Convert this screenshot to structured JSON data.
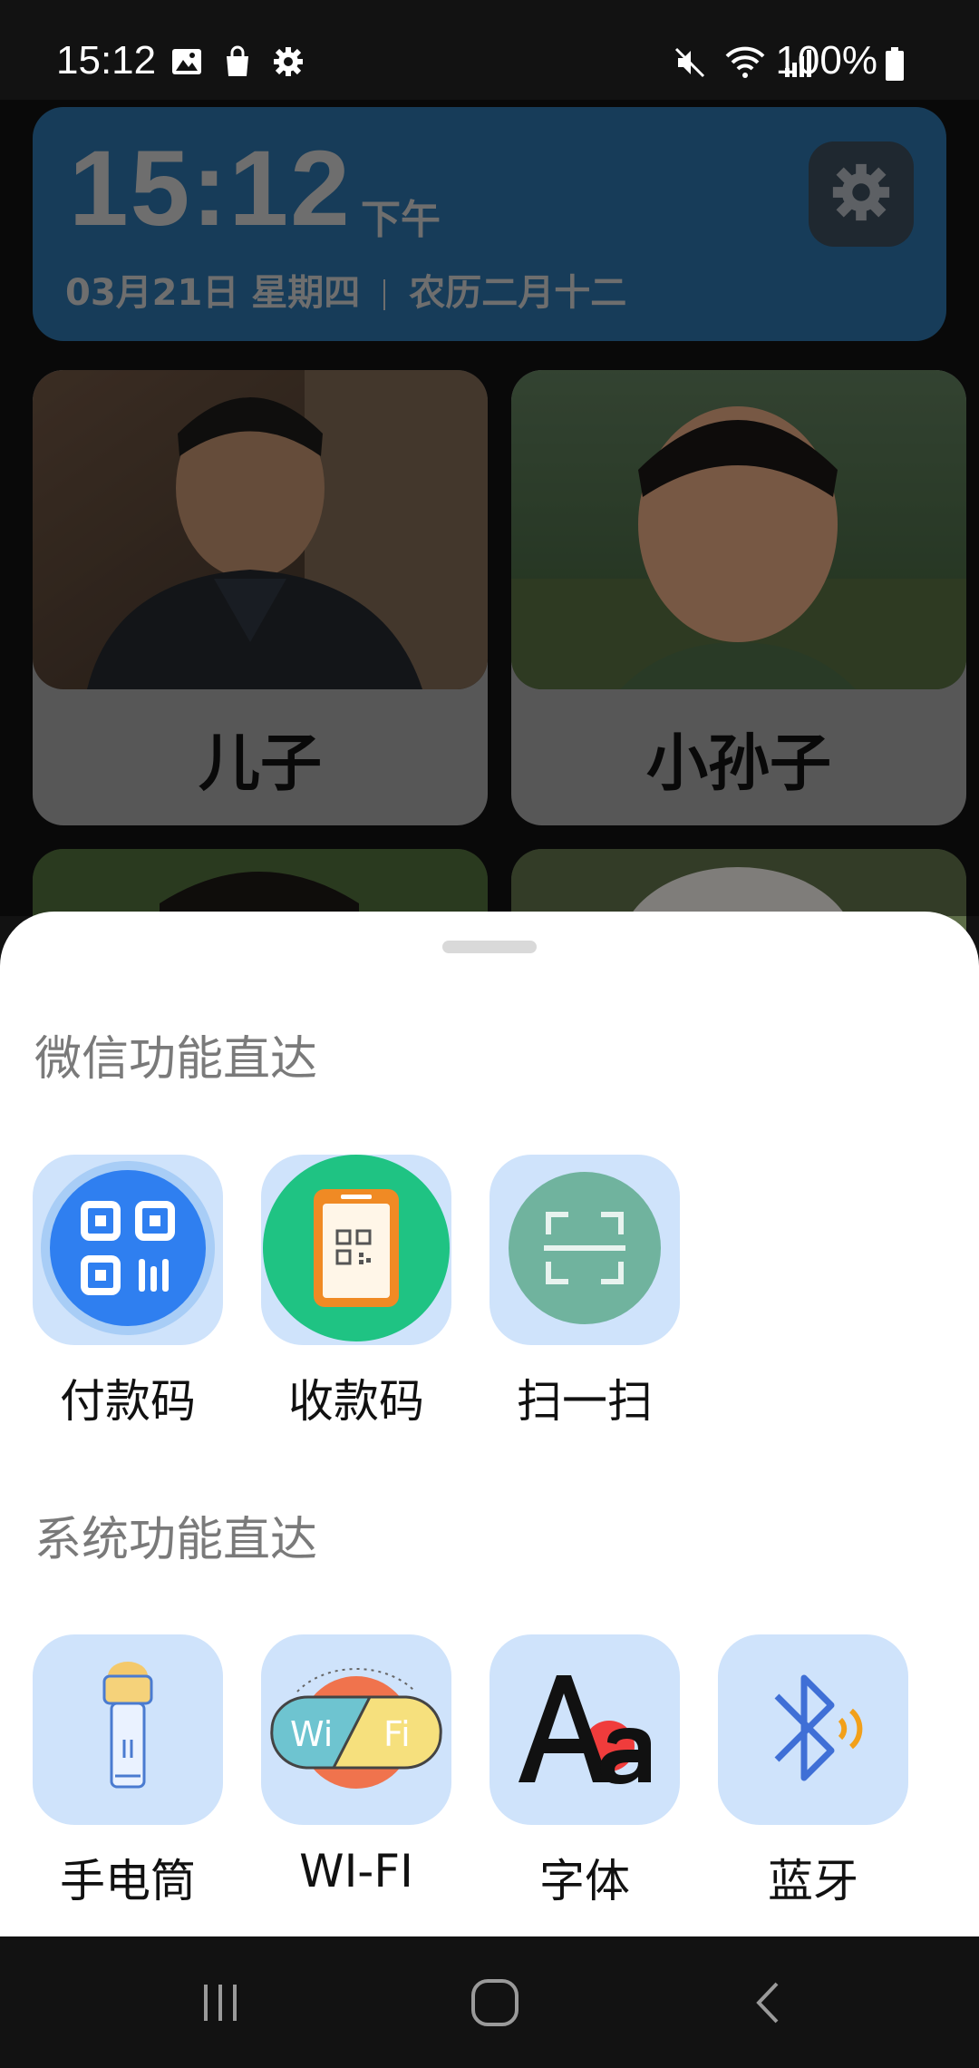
{
  "status_bar": {
    "time": "15:12",
    "battery": "100%",
    "icons_left": [
      "image-icon",
      "shopping-bag-icon",
      "gear-icon"
    ],
    "icons_right": [
      "mute-icon",
      "wifi-icon",
      "signal-icon",
      "battery-icon"
    ]
  },
  "clock": {
    "time": "15:12",
    "ampm": "下午",
    "date": "03月21日  星期四",
    "lunar": "农历二月十二",
    "card_color": "#2a6ea2"
  },
  "contacts": [
    {
      "name": "儿子"
    },
    {
      "name": "小孙子"
    }
  ],
  "sheet": {
    "wechat_title": "微信功能直达",
    "wechat_items": [
      {
        "label": "付款码",
        "icon": "payment-qr-icon"
      },
      {
        "label": "收款码",
        "icon": "receive-qr-icon"
      },
      {
        "label": "扫一扫",
        "icon": "scan-icon"
      }
    ],
    "system_title": "系统功能直达",
    "system_items": [
      {
        "label": "手电筒",
        "icon": "flashlight-icon"
      },
      {
        "label": "WI-FI",
        "icon": "wifi-icon"
      },
      {
        "label": "字体",
        "icon": "font-icon"
      },
      {
        "label": "蓝牙",
        "icon": "bluetooth-icon"
      }
    ]
  },
  "navbar": {
    "buttons": [
      "recents-icon",
      "home-icon",
      "back-icon"
    ]
  },
  "colors": {
    "accent_blue": "#2f7ff0",
    "accent_green": "#1fc383",
    "tile_bg": "#cfe3fb"
  }
}
